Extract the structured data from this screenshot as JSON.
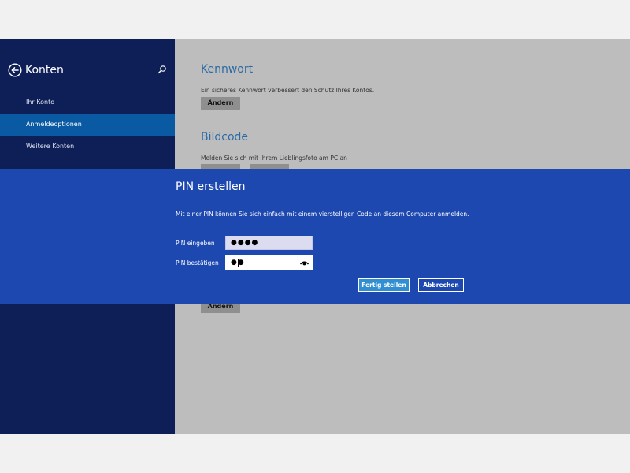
{
  "sidebar": {
    "title": "Konten",
    "items": [
      {
        "label": "Ihr Konto"
      },
      {
        "label": "Anmeldeoptionen"
      },
      {
        "label": "Weitere Konten"
      }
    ]
  },
  "content": {
    "password": {
      "title": "Kennwort",
      "description": "Ein sicheres Kennwort verbessert den Schutz Ihres Kontos.",
      "button": "Ändern"
    },
    "picture_code": {
      "title": "Bildcode",
      "description": "Melden Sie sich mit Ihrem Lieblingsfoto am PC an"
    },
    "bottom_button": "Ändern"
  },
  "dialog": {
    "title": "PIN erstellen",
    "description": "Mit einer PIN können Sie sich einfach mit einem vierstelligen Code an diesem Computer anmelden.",
    "pin_label": "PIN eingeben",
    "pin_value": "●●●●",
    "confirm_label": "PIN bestätigen",
    "confirm_value": "●●",
    "ok_button": "Fertig stellen",
    "cancel_button": "Abbrechen"
  },
  "colors": {
    "sidebar_bg": "#0e1f57",
    "sidebar_active": "#0a5aa3",
    "dialog_bg": "#1c48b0",
    "content_bg": "#bdbdbd",
    "accent_title": "#2b6aa5"
  }
}
